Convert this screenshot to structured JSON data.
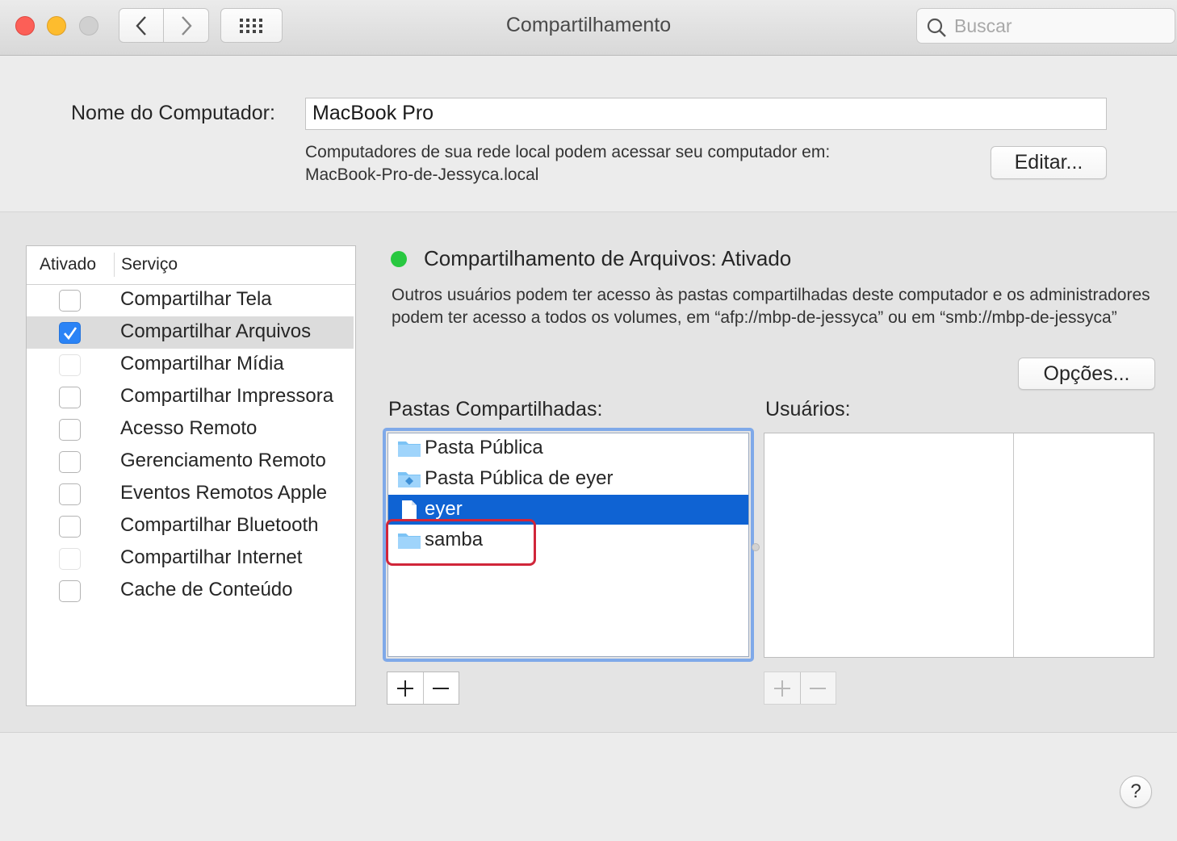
{
  "window": {
    "title": "Compartilhamento"
  },
  "toolbar": {
    "search_placeholder": "Buscar"
  },
  "computer_name": {
    "label": "Nome do Computador:",
    "value": "MacBook Pro",
    "info_line1": "Computadores de sua rede local podem acessar seu computador em:",
    "info_line2": "MacBook-Pro-de-Jessyca.local",
    "edit_button": "Editar..."
  },
  "services": {
    "header_enabled": "Ativado",
    "header_service": "Serviço",
    "items": [
      {
        "label": "Compartilhar Tela",
        "checked": false
      },
      {
        "label": "Compartilhar Arquivos",
        "checked": true
      },
      {
        "label": "Compartilhar Mídia",
        "checked": false
      },
      {
        "label": "Compartilhar Impressora",
        "checked": false
      },
      {
        "label": "Acesso Remoto",
        "checked": false
      },
      {
        "label": "Gerenciamento Remoto",
        "checked": false
      },
      {
        "label": "Eventos Remotos Apple",
        "checked": false
      },
      {
        "label": "Compartilhar Bluetooth",
        "checked": false
      },
      {
        "label": "Compartilhar Internet",
        "checked": false
      },
      {
        "label": "Cache de Conteúdo",
        "checked": false
      }
    ]
  },
  "status": {
    "title": "Compartilhamento de Arquivos: Ativado",
    "description": "Outros usuários podem ter acesso às pastas compartilhadas deste computador e os administradores podem ter acesso a todos os volumes, em “afp://mbp-de-jessyca” ou em “smb://mbp-de-jessyca”",
    "options_button": "Opções...",
    "indicator_color": "#28c840"
  },
  "shared_folders": {
    "label": "Pastas Compartilhadas:",
    "items": [
      {
        "label": "Pasta Pública",
        "icon": "folder-icon"
      },
      {
        "label": "Pasta Pública de eyer",
        "icon": "public-folder-icon"
      },
      {
        "label": "eyer",
        "icon": "document-icon",
        "selected": true
      },
      {
        "label": "samba",
        "icon": "folder-icon"
      }
    ],
    "add": "+",
    "remove": "−"
  },
  "users": {
    "label": "Usuários:",
    "add": "+",
    "remove": "−"
  },
  "help": {
    "label": "?"
  }
}
